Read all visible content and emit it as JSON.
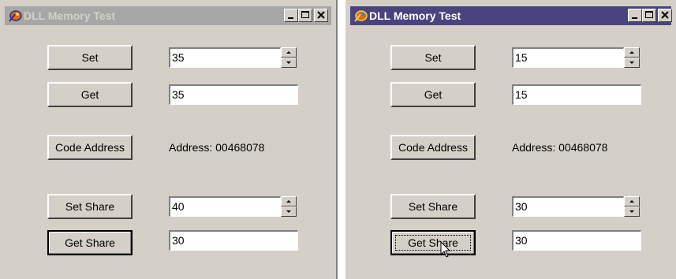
{
  "windows": [
    {
      "id": "left",
      "title": "DLL Memory Test",
      "set_button": "Set",
      "get_button": "Get",
      "code_address_button": "Code Address",
      "set_share_button": "Set Share",
      "get_share_button": "Get Share",
      "set_value": "35",
      "get_value": "35",
      "address_text": "Address: 00468078",
      "set_share_value": "40",
      "get_share_value": "30"
    },
    {
      "id": "right",
      "title": "DLL Memory Test",
      "set_button": "Set",
      "get_button": "Get",
      "code_address_button": "Code Address",
      "set_share_button": "Set Share",
      "get_share_button": "Get Share",
      "set_value": "15",
      "get_value": "15",
      "address_text": "Address: 00468078",
      "set_share_value": "30",
      "get_share_value": "30"
    }
  ],
  "colors": {
    "face": "#d4d0c8",
    "title_inactive": "#a7a7a7",
    "title_active": "#4a447e"
  },
  "icons": {
    "app_icon": "app-icon",
    "minimize": "minimize-icon",
    "maximize": "maximize-icon",
    "close": "close-icon",
    "cursor": "mouse-pointer-icon"
  }
}
